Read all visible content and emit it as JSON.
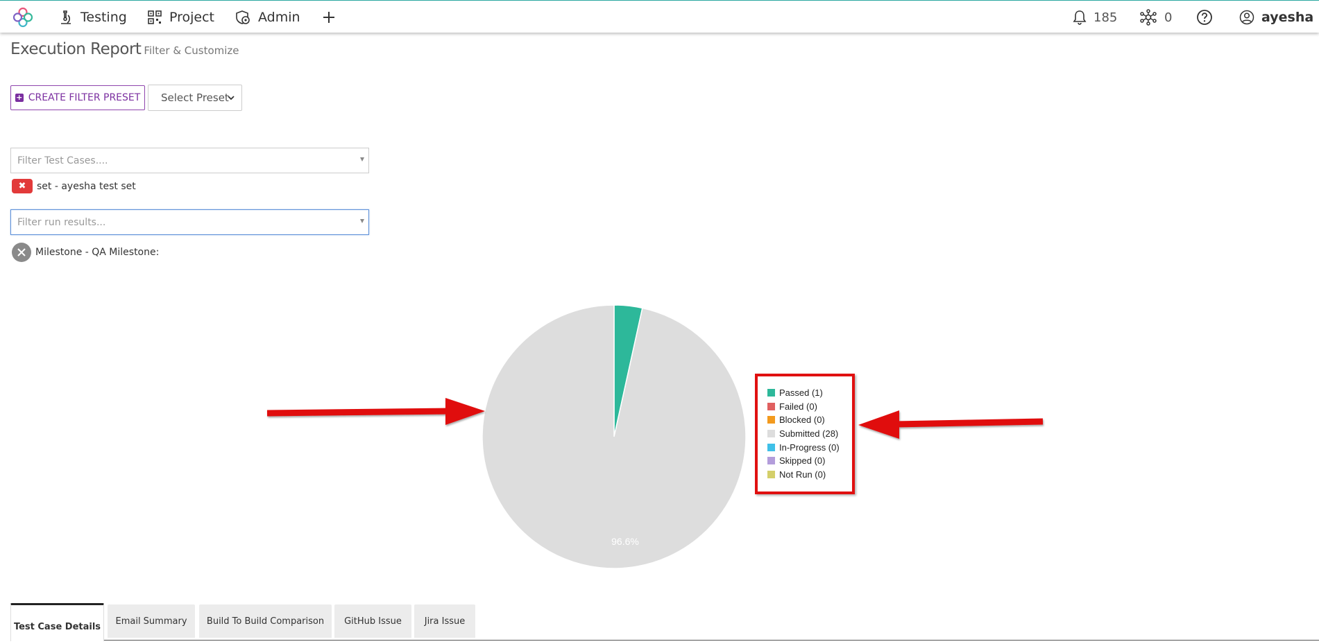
{
  "nav": {
    "items": [
      {
        "label": "Testing",
        "icon": "microscope-icon"
      },
      {
        "label": "Project",
        "icon": "qr-grid-icon"
      },
      {
        "label": "Admin",
        "icon": "gear-shield-icon"
      }
    ],
    "add_icon": "plus-icon",
    "notifications_count": "185",
    "network_count": "0",
    "help_icon": "question-icon",
    "user_name": "ayesha"
  },
  "page": {
    "title": "Execution Report",
    "subtitle": "Filter & Customize"
  },
  "toolbar": {
    "create_preset_label": "CREATE FILTER PRESET",
    "select_preset_label": "Select Preset"
  },
  "filters": {
    "test_cases_placeholder": "Filter Test Cases....",
    "test_case_tag": "set - ayesha test set",
    "run_results_placeholder": "Filter run results...",
    "run_result_tag": "Milestone - QA Milestone:"
  },
  "chart_data": {
    "type": "pie",
    "series": [
      {
        "name": "Passed",
        "label": "Passed (1)",
        "value": 1,
        "color": "#2db89a"
      },
      {
        "name": "Failed",
        "label": "Failed (0)",
        "value": 0,
        "color": "#e06060"
      },
      {
        "name": "Blocked",
        "label": "Blocked (0)",
        "value": 0,
        "color": "#f39a1e"
      },
      {
        "name": "Submitted",
        "label": "Submitted (28)",
        "value": 28,
        "color": "#dddddd"
      },
      {
        "name": "In-Progress",
        "label": "In-Progress (0)",
        "value": 0,
        "color": "#3fc0e8"
      },
      {
        "name": "Skipped",
        "label": "Skipped (0)",
        "value": 0,
        "color": "#b39ddb"
      },
      {
        "name": "Not Run",
        "label": "Not Run (0)",
        "value": 0,
        "color": "#d4cf6a"
      }
    ],
    "slice_label": "96.6%",
    "legend_position": "right"
  },
  "tabs": [
    {
      "label": "Test Case Details",
      "active": true
    },
    {
      "label": "Email Summary",
      "active": false
    },
    {
      "label": "Build To Build Comparison",
      "active": false
    },
    {
      "label": "GitHub Issue",
      "active": false
    },
    {
      "label": "Jira Issue",
      "active": false
    }
  ],
  "colors": {
    "accent": "#7b2fa0",
    "teal": "#2aa7a0",
    "annotation_red": "#e01010"
  }
}
